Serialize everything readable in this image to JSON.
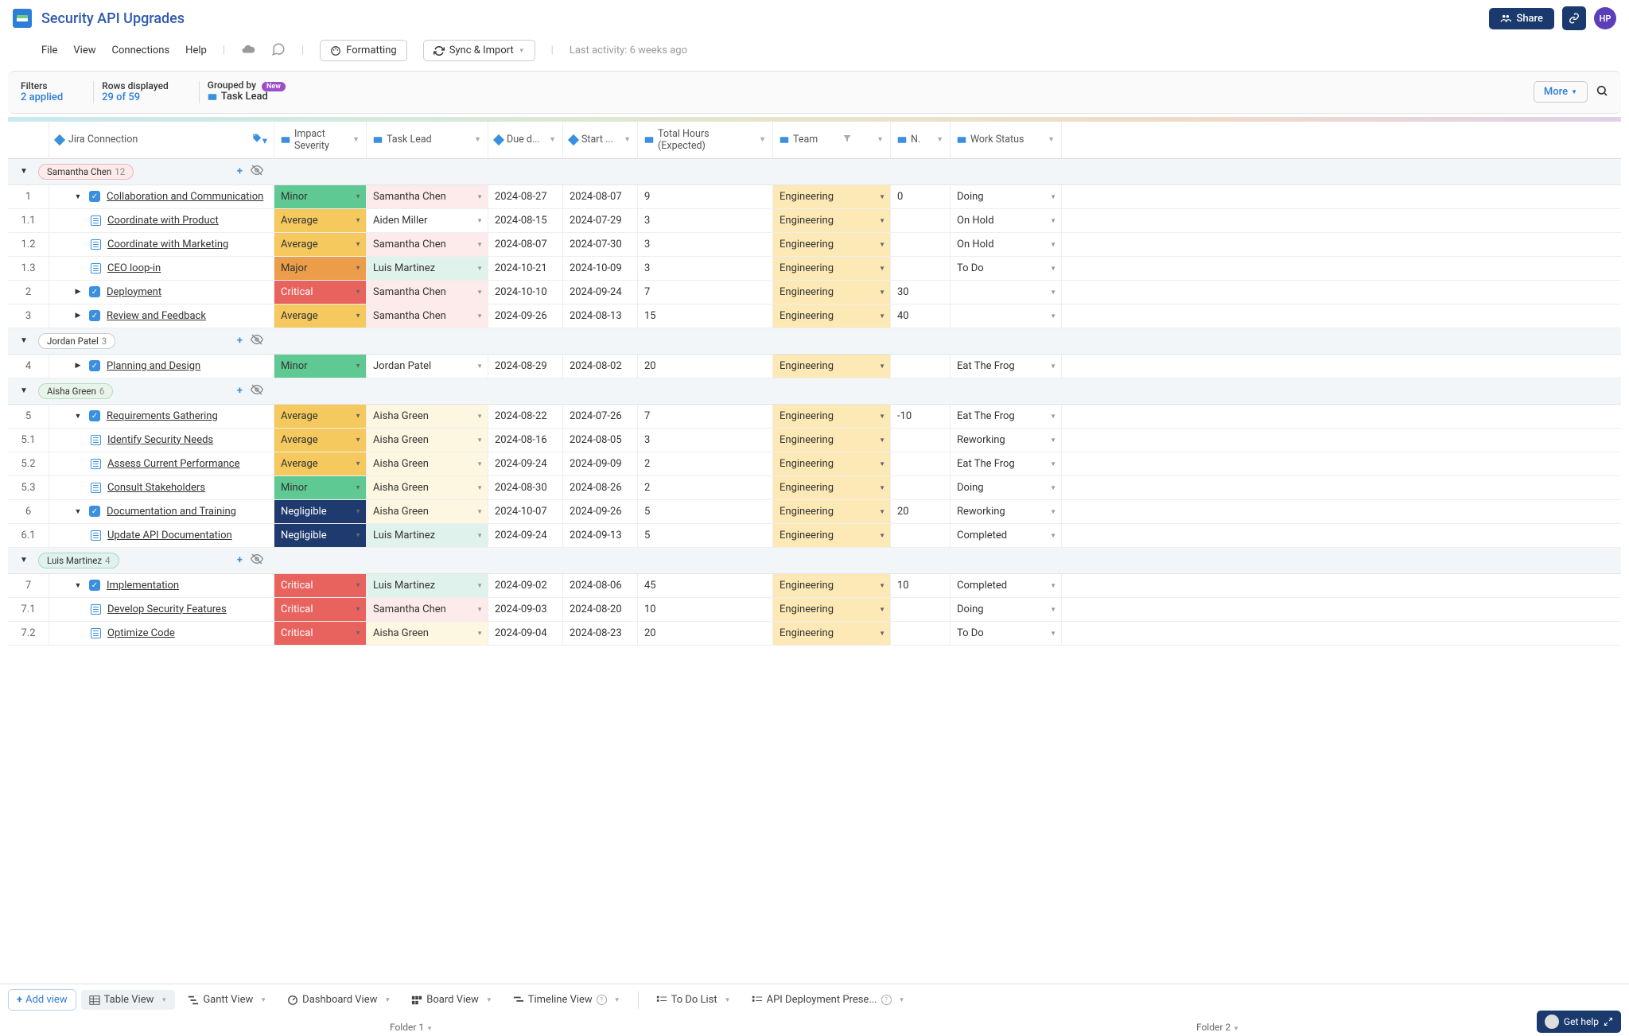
{
  "header": {
    "title": "Security API Upgrades",
    "share_label": "Share",
    "avatar_initials": "HP"
  },
  "menu": {
    "file": "File",
    "view": "View",
    "connections": "Connections",
    "help": "Help",
    "formatting": "Formatting",
    "sync_import": "Sync & Import",
    "last_activity_label": "Last activity:",
    "last_activity_value": "6 weeks ago"
  },
  "filters": {
    "filters_label": "Filters",
    "filters_value": "2 applied",
    "rows_label": "Rows displayed",
    "rows_value": "29 of 59",
    "grouped_label": "Grouped by",
    "new_badge": "New",
    "grouped_value": "Task Lead",
    "more": "More"
  },
  "columns": {
    "jira": "Jira Connection",
    "impact": "Impact Severity",
    "lead": "Task Lead",
    "due": "Due d...",
    "start": "Start ...",
    "hours": "Total Hours (Expected)",
    "team": "Team",
    "n": "N.",
    "status": "Work Status"
  },
  "groups": [
    {
      "name": "Samantha Chen",
      "count": "12",
      "chip_bg": "#fdeaea",
      "chip_border": "#e9b8b8",
      "rows": [
        {
          "idx": "1",
          "caret": "down",
          "check": true,
          "indent": 1,
          "task": "Collaboration and Communication",
          "impact": "Minor",
          "imp_cls": "imp-minor",
          "lead": "Samantha Chen",
          "lead_cls": "lead-samantha",
          "due": "2024-08-27",
          "start": "2024-08-07",
          "hours": "9",
          "team": "Engineering",
          "n": "0",
          "status": "Doing"
        },
        {
          "idx": "1.1",
          "caret": "",
          "check": false,
          "indent": 2,
          "task": "Coordinate with Product",
          "impact": "Average",
          "imp_cls": "imp-average",
          "lead": "Aiden Miller",
          "lead_cls": "lead-aiden",
          "due": "2024-08-15",
          "start": "2024-07-29",
          "hours": "3",
          "team": "Engineering",
          "n": "",
          "status": "On Hold"
        },
        {
          "idx": "1.2",
          "caret": "",
          "check": false,
          "indent": 2,
          "task": "Coordinate with Marketing",
          "impact": "Average",
          "imp_cls": "imp-average",
          "lead": "Samantha Chen",
          "lead_cls": "lead-samantha",
          "due": "2024-08-07",
          "start": "2024-07-30",
          "hours": "3",
          "team": "Engineering",
          "n": "",
          "status": "On Hold"
        },
        {
          "idx": "1.3",
          "caret": "",
          "check": false,
          "indent": 2,
          "task": "CEO loop-in",
          "impact": "Major",
          "imp_cls": "imp-major",
          "lead": "Luis Martinez",
          "lead_cls": "lead-luis",
          "due": "2024-10-21",
          "start": "2024-10-09",
          "hours": "3",
          "team": "Engineering",
          "n": "",
          "status": "To Do"
        },
        {
          "idx": "2",
          "caret": "right",
          "check": true,
          "indent": 1,
          "task": "Deployment",
          "impact": "Critical",
          "imp_cls": "imp-critical",
          "lead": "Samantha Chen",
          "lead_cls": "lead-samantha",
          "due": "2024-10-10",
          "start": "2024-09-24",
          "hours": "7",
          "team": "Engineering",
          "n": "30",
          "status": ""
        },
        {
          "idx": "3",
          "caret": "right",
          "check": true,
          "indent": 1,
          "task": "Review and Feedback",
          "impact": "Average",
          "imp_cls": "imp-average",
          "lead": "Samantha Chen",
          "lead_cls": "lead-samantha",
          "due": "2024-09-26",
          "start": "2024-08-13",
          "hours": "15",
          "team": "Engineering",
          "n": "40",
          "status": ""
        }
      ]
    },
    {
      "name": "Jordan Patel",
      "count": "3",
      "chip_bg": "#fff",
      "chip_border": "#ccc",
      "rows": [
        {
          "idx": "4",
          "caret": "right",
          "check": true,
          "indent": 1,
          "task": "Planning and Design",
          "impact": "Minor",
          "imp_cls": "imp-minor",
          "lead": "Jordan Patel",
          "lead_cls": "lead-jordan",
          "due": "2024-08-29",
          "start": "2024-08-02",
          "hours": "20",
          "team": "Engineering",
          "n": "",
          "status": "Eat The Frog"
        }
      ]
    },
    {
      "name": "Aisha Green",
      "count": "6",
      "chip_bg": "#e8f4ea",
      "chip_border": "#b8dcc0",
      "rows": [
        {
          "idx": "5",
          "caret": "down",
          "check": true,
          "indent": 1,
          "task": "Requirements Gathering",
          "impact": "Average",
          "imp_cls": "imp-average",
          "lead": "Aisha Green",
          "lead_cls": "lead-aisha",
          "due": "2024-08-22",
          "start": "2024-07-26",
          "hours": "7",
          "team": "Engineering",
          "n": "-10",
          "status": "Eat The Frog"
        },
        {
          "idx": "5.1",
          "caret": "",
          "check": false,
          "indent": 2,
          "task": "Identify Security Needs",
          "impact": "Average",
          "imp_cls": "imp-average",
          "lead": "Aisha Green",
          "lead_cls": "lead-aisha",
          "due": "2024-08-16",
          "start": "2024-08-05",
          "hours": "3",
          "team": "Engineering",
          "n": "",
          "status": "Reworking"
        },
        {
          "idx": "5.2",
          "caret": "",
          "check": false,
          "indent": 2,
          "task": "Assess Current Performance",
          "impact": "Average",
          "imp_cls": "imp-average",
          "lead": "Aisha Green",
          "lead_cls": "lead-aisha",
          "due": "2024-09-24",
          "start": "2024-09-09",
          "hours": "2",
          "team": "Engineering",
          "n": "",
          "status": "Eat The Frog"
        },
        {
          "idx": "5.3",
          "caret": "",
          "check": false,
          "indent": 2,
          "task": "Consult Stakeholders",
          "impact": "Minor",
          "imp_cls": "imp-minor",
          "lead": "Aisha Green",
          "lead_cls": "lead-aisha",
          "due": "2024-08-30",
          "start": "2024-08-26",
          "hours": "2",
          "team": "Engineering",
          "n": "",
          "status": "Doing"
        },
        {
          "idx": "6",
          "caret": "down",
          "check": true,
          "indent": 1,
          "task": "Documentation and Training",
          "impact": "Negligible",
          "imp_cls": "imp-negligible",
          "lead": "Aisha Green",
          "lead_cls": "lead-aisha",
          "due": "2024-10-07",
          "start": "2024-09-26",
          "hours": "5",
          "team": "Engineering",
          "n": "20",
          "status": "Reworking"
        },
        {
          "idx": "6.1",
          "caret": "",
          "check": false,
          "indent": 2,
          "task": "Update API Documentation",
          "impact": "Negligible",
          "imp_cls": "imp-negligible",
          "lead": "Luis Martinez",
          "lead_cls": "lead-luis",
          "due": "2024-09-24",
          "start": "2024-09-13",
          "hours": "5",
          "team": "Engineering",
          "n": "",
          "status": "Completed"
        }
      ]
    },
    {
      "name": "Luis Martinez",
      "count": "4",
      "chip_bg": "#e0f2ec",
      "chip_border": "#a8d8c8",
      "rows": [
        {
          "idx": "7",
          "caret": "down",
          "check": true,
          "indent": 1,
          "task": "Implementation",
          "impact": "Critical",
          "imp_cls": "imp-critical",
          "lead": "Luis Martinez",
          "lead_cls": "lead-luis",
          "due": "2024-09-02",
          "start": "2024-08-06",
          "hours": "45",
          "team": "Engineering",
          "n": "10",
          "status": "Completed"
        },
        {
          "idx": "7.1",
          "caret": "",
          "check": false,
          "indent": 2,
          "task": "Develop Security Features",
          "impact": "Critical",
          "imp_cls": "imp-critical",
          "lead": "Samantha Chen",
          "lead_cls": "lead-samantha",
          "due": "2024-09-03",
          "start": "2024-08-20",
          "hours": "10",
          "team": "Engineering",
          "n": "",
          "status": "Doing"
        },
        {
          "idx": "7.2",
          "caret": "",
          "check": false,
          "indent": 2,
          "task": "Optimize Code",
          "impact": "Critical",
          "imp_cls": "imp-critical",
          "lead": "Aisha Green",
          "lead_cls": "lead-aisha",
          "due": "2024-09-04",
          "start": "2024-08-23",
          "hours": "20",
          "team": "Engineering",
          "n": "",
          "status": "To Do"
        }
      ]
    }
  ],
  "tabs": {
    "add_view": "Add view",
    "table": "Table View",
    "gantt": "Gantt View",
    "dashboard": "Dashboard View",
    "board": "Board View",
    "timeline": "Timeline View",
    "todo": "To Do List",
    "api_deploy": "API Deployment Prese..."
  },
  "folders": {
    "f1": "Folder 1",
    "f2": "Folder 2"
  },
  "help": {
    "label": "Get help"
  }
}
